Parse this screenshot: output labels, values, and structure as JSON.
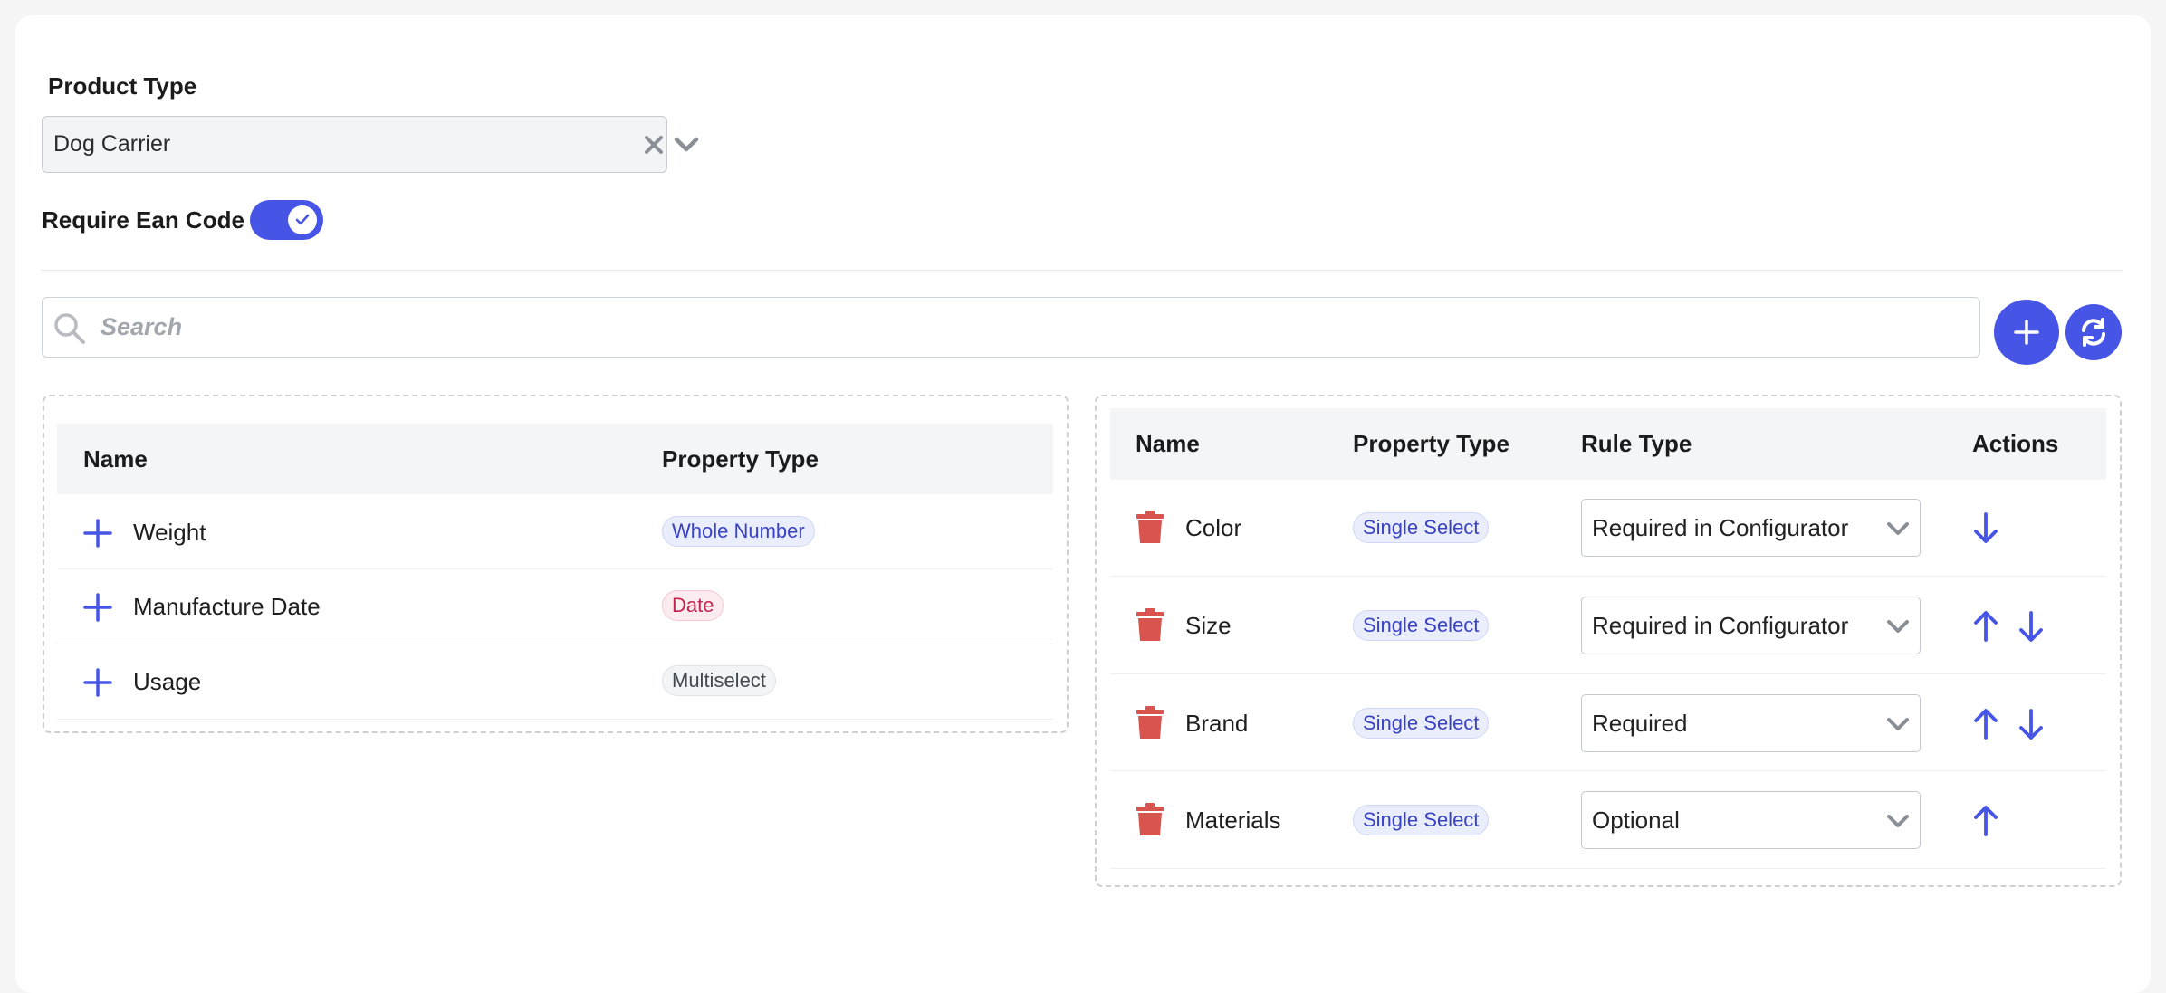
{
  "product_type": {
    "label": "Product Type",
    "value": "Dog Carrier"
  },
  "ean": {
    "label": "Require Ean Code",
    "enabled": true
  },
  "search": {
    "placeholder": "Search"
  },
  "colors": {
    "accent": "#4755e6",
    "danger": "#d9534f"
  },
  "available": {
    "headers": {
      "name": "Name",
      "property_type": "Property Type"
    },
    "rows": [
      {
        "name": "Weight",
        "property_type": "Whole Number",
        "badge": "blue"
      },
      {
        "name": "Manufacture Date",
        "property_type": "Date",
        "badge": "date"
      },
      {
        "name": "Usage",
        "property_type": "Multiselect",
        "badge": "gray"
      }
    ]
  },
  "assigned": {
    "headers": {
      "name": "Name",
      "property_type": "Property Type",
      "rule_type": "Rule Type",
      "actions": "Actions"
    },
    "rows": [
      {
        "name": "Color",
        "property_type": "Single Select",
        "rule_type": "Required in Configurator",
        "actions": [
          "arrow-down-icon"
        ]
      },
      {
        "name": "Size",
        "property_type": "Single Select",
        "rule_type": "Required in Configurator",
        "actions": [
          "arrow-up-icon",
          "arrow-down-icon"
        ]
      },
      {
        "name": "Brand",
        "property_type": "Single Select",
        "rule_type": "Required",
        "actions": [
          "arrow-up-icon",
          "arrow-down-icon"
        ]
      },
      {
        "name": "Materials",
        "property_type": "Single Select",
        "rule_type": "Optional",
        "actions": [
          "arrow-up-icon"
        ]
      }
    ]
  }
}
